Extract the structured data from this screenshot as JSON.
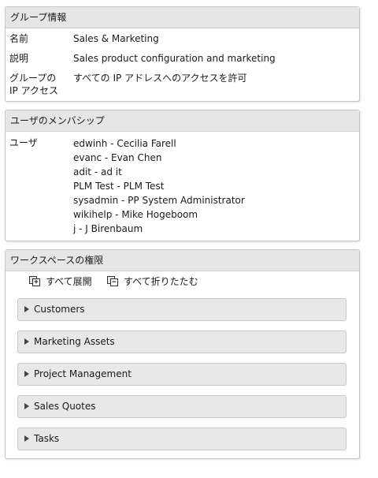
{
  "group_info": {
    "title": "グループ情報",
    "name_label": "名前",
    "name_value": "Sales & Marketing",
    "desc_label": "説明",
    "desc_value": "Sales product configuration and marketing",
    "ip_label_line1": "グループの",
    "ip_label_line2": "IP アクセス",
    "ip_value": "すべての IP アドレスへのアクセスを許可"
  },
  "membership": {
    "title": "ユーザのメンバシップ",
    "users_label": "ユーザ",
    "members": [
      "edwinh - Cecilia Farell",
      "evanc - Evan Chen",
      "adit - ad it",
      "PLM Test - PLM Test",
      "sysadmin - PP System Administrator",
      "wikihelp - Mike Hogeboom",
      "j - J Birenbaum"
    ]
  },
  "workspaces": {
    "title": "ワークスペースの権限",
    "expand_all": "すべて展開",
    "collapse_all": "すべて折りたたむ",
    "items": [
      "Customers",
      "Marketing Assets",
      "Project Management",
      "Sales Quotes",
      "Tasks"
    ]
  }
}
